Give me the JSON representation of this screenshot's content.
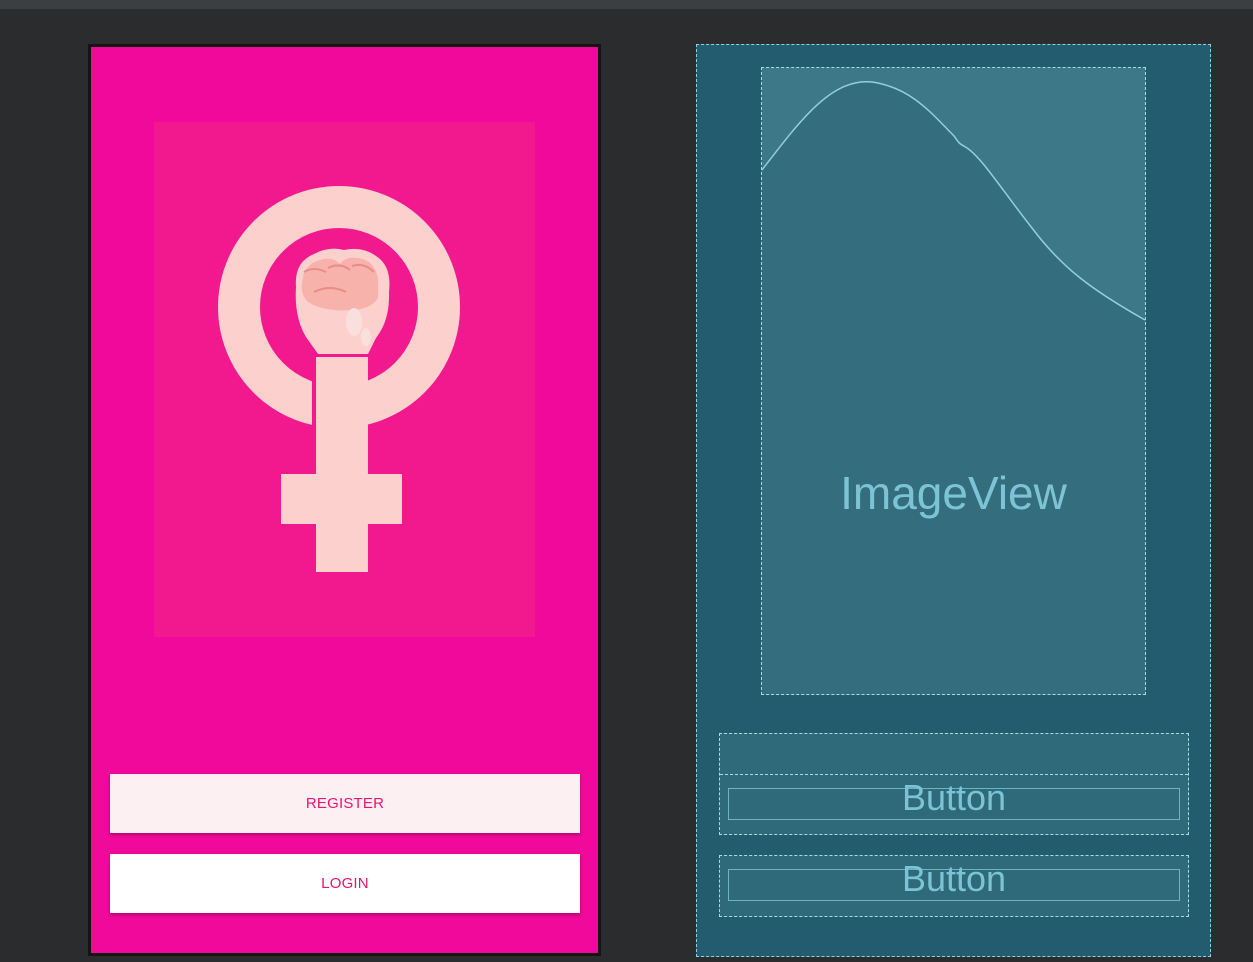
{
  "design_preview": {
    "background_color": "#f0099a",
    "hero_panel_color": "#f2198f",
    "hero_image_icon": "female-symbol-raised-fist-icon",
    "buttons": [
      {
        "label": "REGISTER"
      },
      {
        "label": "LOGIN"
      }
    ],
    "button_text_color": "#e8156f"
  },
  "blueprint_preview": {
    "background_color": "#245c6f",
    "image_view": {
      "label": "ImageView"
    },
    "buttons": [
      {
        "label": "Button"
      },
      {
        "label": "Button"
      }
    ],
    "accent_color": "#7cc4d5"
  }
}
